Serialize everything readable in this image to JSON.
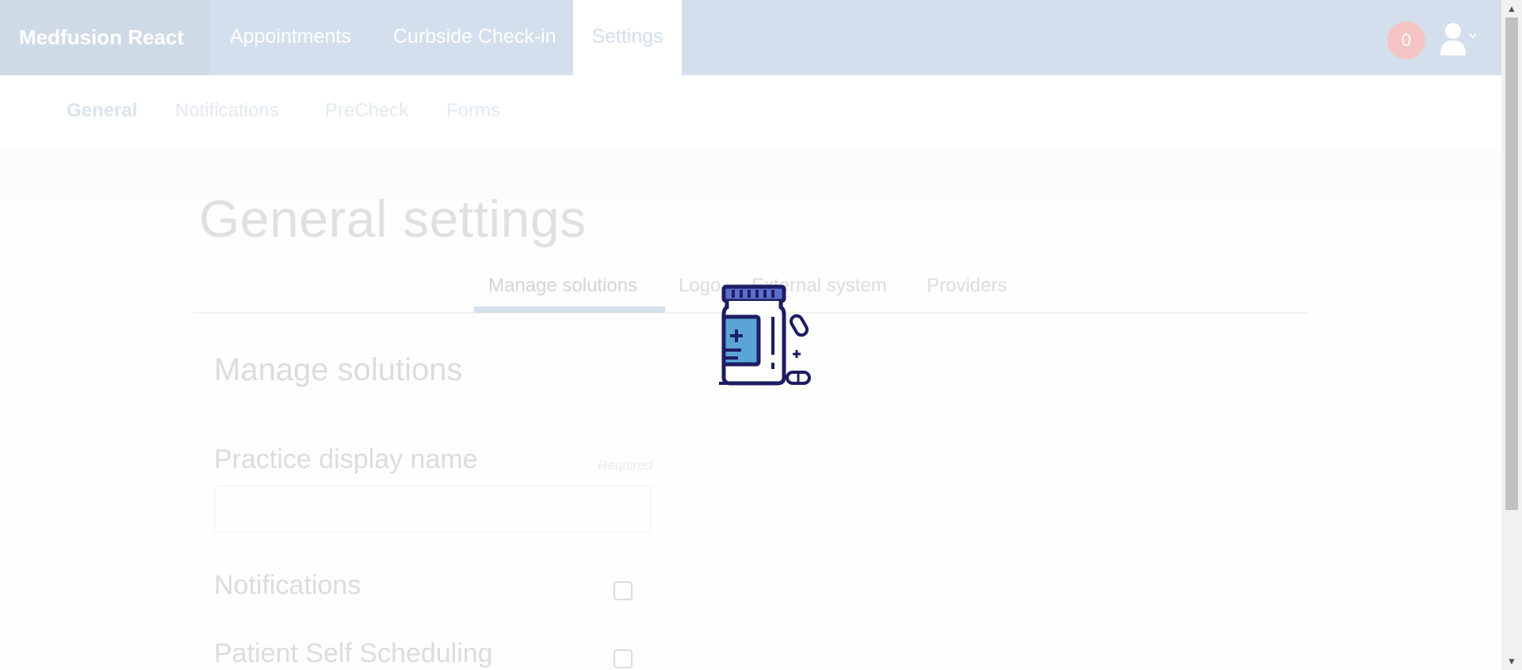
{
  "navbar": {
    "brand": "Medfusion React",
    "links": [
      {
        "label": "Appointments"
      },
      {
        "label": "Curbside Check-in"
      },
      {
        "label": "Settings"
      }
    ],
    "notification_count": "0",
    "avatar_icon": "user-icon",
    "dropdown_icon": "chevron-down-icon"
  },
  "subnav": {
    "items": [
      {
        "label": "General"
      },
      {
        "label": "Notifications"
      },
      {
        "label": "PreCheck"
      },
      {
        "label": "Forms"
      }
    ]
  },
  "main": {
    "title": "General settings",
    "tabs": [
      {
        "label": "Manage solutions"
      },
      {
        "label": "Logo"
      },
      {
        "label": "External system"
      },
      {
        "label": "Providers"
      }
    ],
    "section_title": "Manage solutions",
    "practice_display_name": {
      "label": "Practice display name",
      "required_hint": "Required",
      "value": ""
    },
    "toggles": [
      {
        "label": "Notifications",
        "checked": false
      },
      {
        "label": "Patient Self Scheduling",
        "checked": false
      }
    ]
  },
  "loader": {
    "icon": "medicine-bottle-icon"
  },
  "colors": {
    "nav_bg": "#d3dfec",
    "loader_outline": "#1d1d63",
    "loader_fill": "#5b6ec9",
    "badge": "#f4c5c2"
  }
}
